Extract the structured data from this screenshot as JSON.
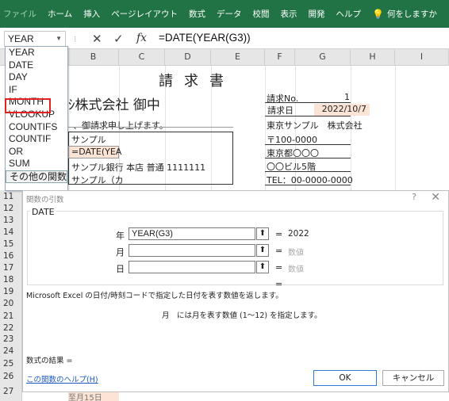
{
  "ribbon": {
    "tabs": [
      "ファイル",
      "ホーム",
      "挿入",
      "ページレイアウト",
      "数式",
      "データ",
      "校閲",
      "表示",
      "開発",
      "ヘルプ"
    ],
    "search": "何をしますか"
  },
  "formula_bar": {
    "name_box": "YEAR",
    "cancel_icon": "✕",
    "enter_icon": "✓",
    "fx": "fx",
    "formula": "=DATE(YEAR(G3))"
  },
  "columns": [
    "B",
    "C",
    "D",
    "E",
    "F",
    "G",
    "H",
    "I"
  ],
  "rows": [
    "11",
    "12",
    "13",
    "14",
    "15",
    "16",
    "17",
    "18",
    "19",
    "20",
    "21",
    "22",
    "23",
    "24",
    "25",
    "26",
    "27"
  ],
  "function_list": [
    "YEAR",
    "DATE",
    "DAY",
    "IF",
    "MONTH",
    "VLOOKUP",
    "COUNTIFS",
    "COUNTIF",
    "OR",
    "SUM",
    "その他の関数..."
  ],
  "sheet": {
    "title": "請求書",
    "company": "ｼ株式会社 御中",
    "invoice_no_label": "請求No.",
    "invoice_no_value": "1",
    "invoice_date_label": "請求日",
    "invoice_date_value": "2022/10/7",
    "greeting": "、御請求申し上げます。",
    "customer": "東京サンプル　株式会社",
    "left_rows": [
      "サンプル",
      "=DATE(YEA",
      "サンプル銀行 本店 普通 1111111",
      "サンプル（カ"
    ],
    "address_rows": [
      "〒100-0000",
      "東京都〇〇〇",
      "〇〇ビル5階",
      "TEL：00-0000-0000"
    ],
    "bottom_cell": "至月15日"
  },
  "dialog": {
    "title": "関数の引数",
    "help_q": "?",
    "close": "✕",
    "function_name": "DATE",
    "args": [
      {
        "label": "年",
        "value": "YEAR(G3)",
        "result": "2022",
        "hint": false
      },
      {
        "label": "月",
        "value": "",
        "result": "数値",
        "hint": true
      },
      {
        "label": "日",
        "value": "",
        "result": "数値",
        "hint": true
      }
    ],
    "equals": "=",
    "description": "Microsoft Excel の日付/時刻コードで指定した日付を表す数値を返します。",
    "arg_description": "月　には月を表す数値 (1～12) を指定します。",
    "result_label": "数式の結果 =",
    "help_link": "この関数のヘルプ(H)",
    "ok": "OK",
    "cancel": "キャンセル"
  },
  "colors": {
    "ribbon": "#217346",
    "highlight": "#e32121",
    "input_cell": "#fbe4d5"
  }
}
